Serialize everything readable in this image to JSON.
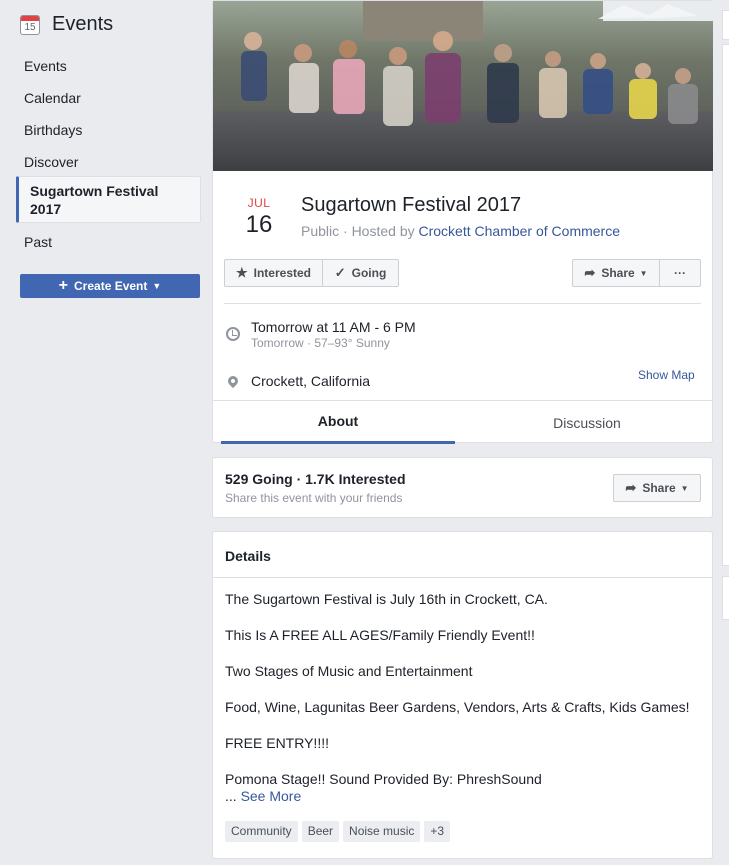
{
  "sidebar": {
    "title": "Events",
    "calendar_icon_number": "15",
    "items": [
      {
        "label": "Events"
      },
      {
        "label": "Calendar"
      },
      {
        "label": "Birthdays"
      },
      {
        "label": "Discover"
      },
      {
        "label": "Sugartown Festival 2017",
        "active": true
      },
      {
        "label": "Past"
      }
    ],
    "create_button_label": "Create Event"
  },
  "event": {
    "month": "JUL",
    "day": "16",
    "title": "Sugartown Festival 2017",
    "privacy": "Public · Hosted by ",
    "host": "Crockett Chamber of Commerce",
    "buttons": {
      "interested": "Interested",
      "going": "Going",
      "share": "Share",
      "more": "···"
    },
    "time": "Tomorrow at 11 AM - 6 PM",
    "weather": "Tomorrow · 57–93° Sunny",
    "location": "Crockett, California",
    "show_map": "Show Map",
    "tabs": [
      {
        "label": "About",
        "active": true
      },
      {
        "label": "Discussion",
        "active": false
      }
    ]
  },
  "stats": {
    "summary": "529 Going · 1.7K Interested",
    "subtitle": "Share this event with your friends",
    "share_label": "Share"
  },
  "details": {
    "heading": "Details",
    "paragraphs": [
      "The Sugartown Festival is July 16th in Crockett, CA.",
      "This Is A FREE ALL AGES/Family Friendly Event!!",
      "Two Stages of Music and Entertainment",
      "Food, Wine, Lagunitas Beer Gardens, Vendors, Arts & Crafts, Kids Games!",
      "FREE ENTRY!!!!",
      "Pomona Stage!! Sound Provided By: PhreshSound"
    ],
    "see_more_prefix": "... ",
    "see_more": "See More",
    "tags": [
      "Community",
      "Beer",
      "Noise music",
      "+3"
    ]
  },
  "colors": {
    "accent": "#4267b2",
    "link": "#365899",
    "month": "#e04343",
    "background": "#e9ebee"
  }
}
